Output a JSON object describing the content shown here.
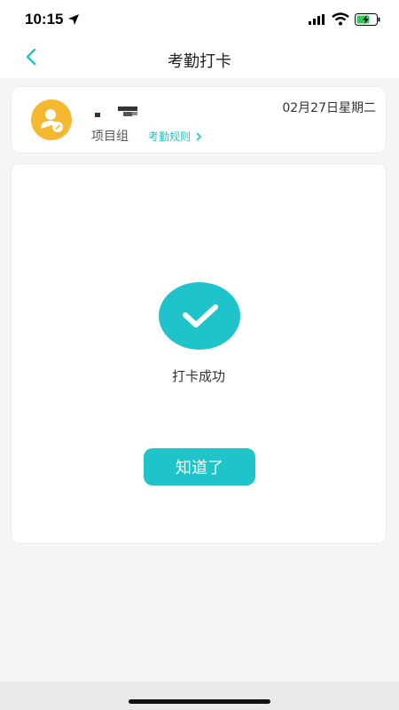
{
  "status_bar": {
    "time": "10:15",
    "icons": [
      "location-arrow-icon",
      "signal-icon",
      "wifi-icon",
      "battery-charging-icon"
    ]
  },
  "nav": {
    "title": "考勤打卡",
    "back_icon": "chevron-left-icon"
  },
  "info_card": {
    "name": "",
    "group": "项目组",
    "rules_link": "考勤规则",
    "date": "02月27日星期二"
  },
  "result": {
    "message": "打卡成功",
    "button_label": "知道了"
  },
  "colors": {
    "accent": "#1ec4c9",
    "avatar": "#f5b82e",
    "background": "#f5f5f5"
  }
}
